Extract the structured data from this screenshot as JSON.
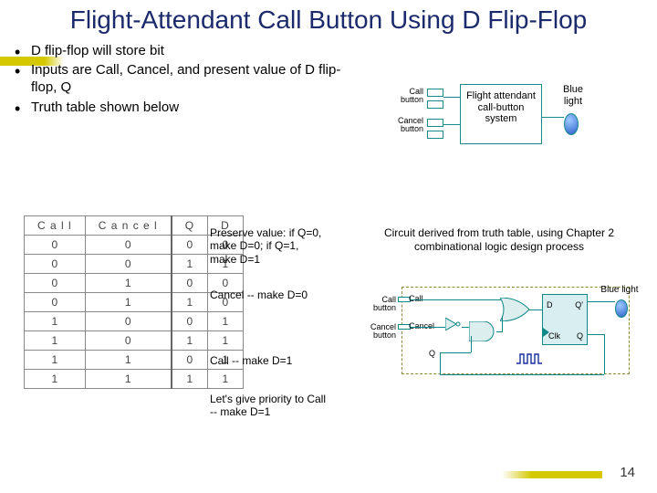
{
  "title": "Flight-Attendant Call Button Using D Flip-Flop",
  "bullets": [
    "D flip-flop will store bit",
    "Inputs are Call, Cancel, and present value of D flip-flop, Q",
    "Truth table shown below"
  ],
  "block_diagram": {
    "call_label": "Call button",
    "cancel_label": "Cancel button",
    "system_label": "Flight attendant call-button system",
    "blue_light_label": "Blue light"
  },
  "truth_table": {
    "headers": [
      "C a l l",
      "C a n c e l",
      "Q",
      "D"
    ],
    "rows": [
      [
        "0",
        "0",
        "0",
        "0"
      ],
      [
        "0",
        "0",
        "1",
        "1"
      ],
      [
        "0",
        "1",
        "0",
        "0"
      ],
      [
        "0",
        "1",
        "1",
        "0"
      ],
      [
        "1",
        "0",
        "0",
        "1"
      ],
      [
        "1",
        "0",
        "1",
        "1"
      ],
      [
        "1",
        "1",
        "0",
        "1"
      ],
      [
        "1",
        "1",
        "1",
        "1"
      ]
    ]
  },
  "annotations": {
    "preserve": "Preserve value: if Q=0, make D=0; if Q=1, make D=1",
    "cancel": "Cancel -- make D=0",
    "call": "Call -- make D=1",
    "priority": "Let's give priority to Call -- make D=1"
  },
  "circuit_caption": "Circuit derived from truth table, using Chapter 2 combinational logic design process",
  "circuit_labels": {
    "call_button": "Call button",
    "cancel_button": "Cancel button",
    "call_pin": "Call",
    "cancel_pin": "Cancel",
    "q_pin": "Q",
    "d_pin": "D",
    "qout_pin": "Q'",
    "qout2_pin": "Q",
    "clk_pin": "Clk",
    "blue_light": "Blue light"
  },
  "page_number": "14"
}
